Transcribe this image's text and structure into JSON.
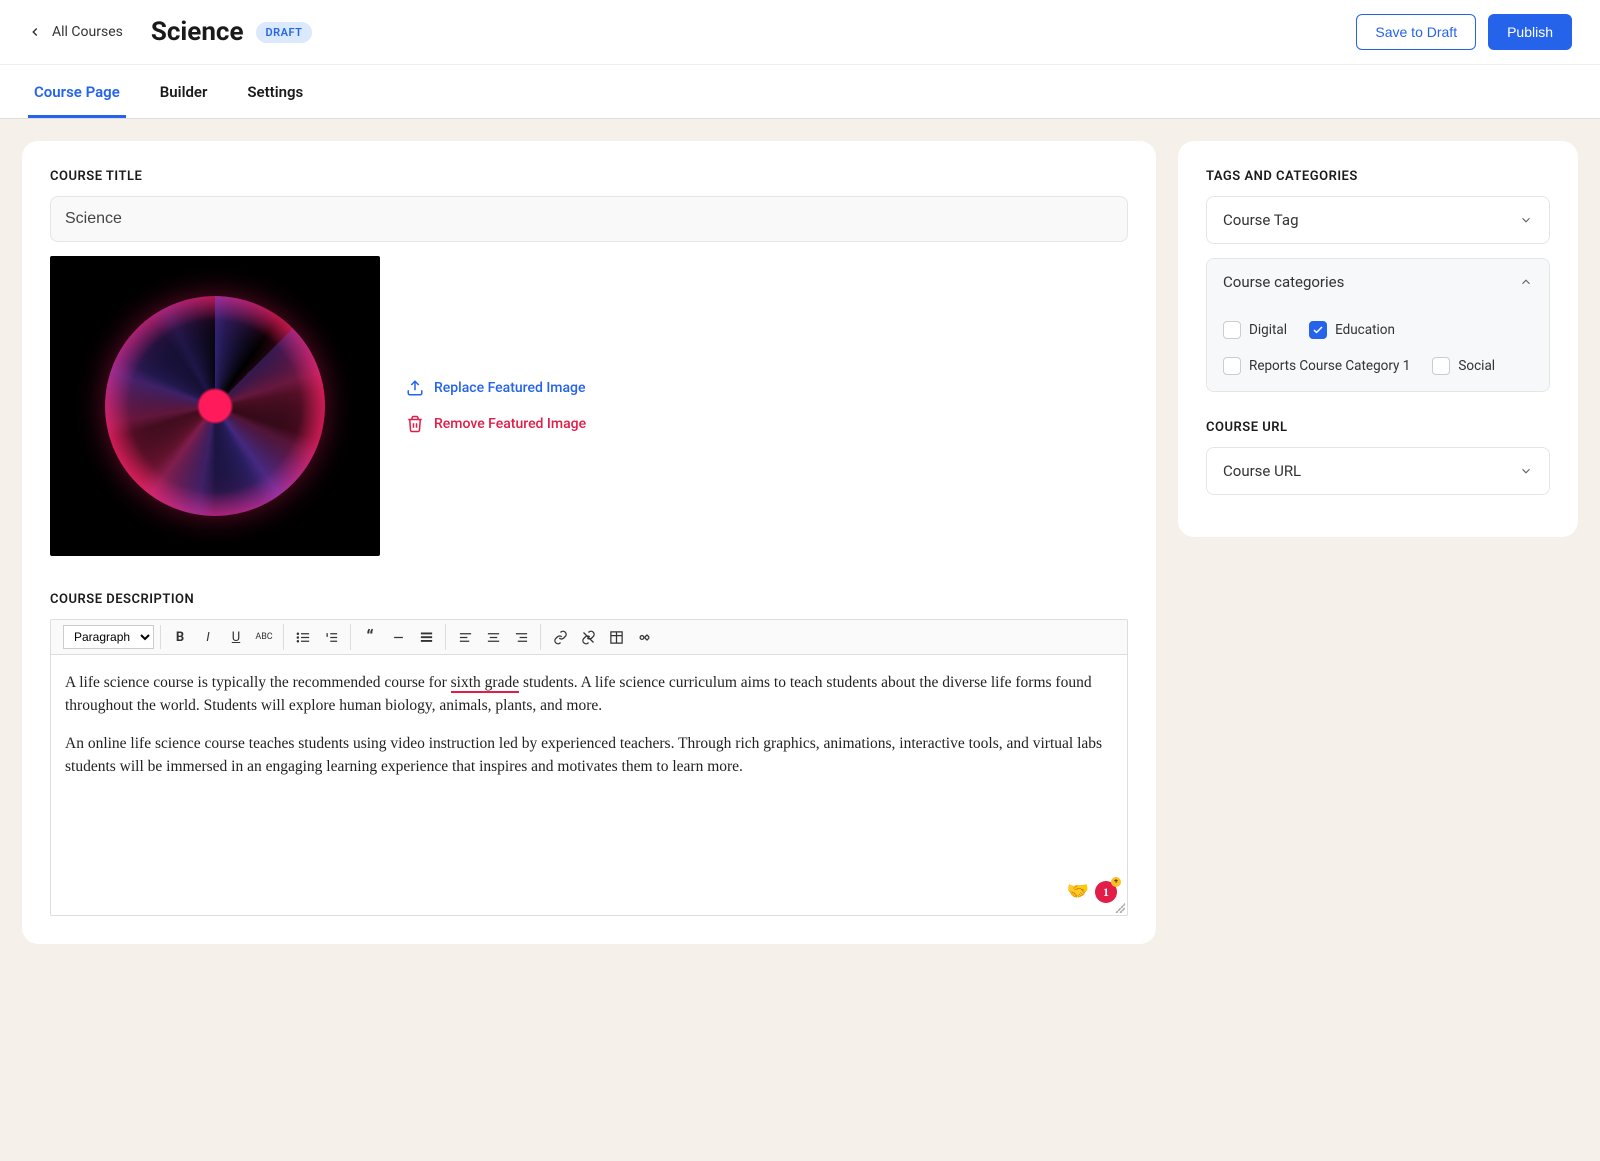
{
  "header": {
    "back_label": "All Courses",
    "title": "Science",
    "status_badge": "DRAFT",
    "save_draft_label": "Save to Draft",
    "publish_label": "Publish"
  },
  "tabs": [
    {
      "label": "Course Page",
      "active": true
    },
    {
      "label": "Builder",
      "active": false
    },
    {
      "label": "Settings",
      "active": false
    }
  ],
  "main": {
    "course_title_label": "COURSE TITLE",
    "course_title_value": "Science",
    "replace_image_label": "Replace Featured Image",
    "remove_image_label": "Remove Featured Image",
    "course_description_label": "COURSE DESCRIPTION",
    "editor_format_value": "Paragraph",
    "description_p1_pre": "A life science course is typically the recommended course for ",
    "description_p1_mark": "sixth grade",
    "description_p1_post": " students. A life science curriculum aims to teach students about the diverse life forms found throughout the world. Students will explore human biology, animals, plants, and more.",
    "description_p2": "An online life science course teaches students using video instruction led by experienced teachers. Through rich graphics, animations, interactive tools, and virtual labs students will be immersed in an engaging learning experience that inspires and motivates them to learn more.",
    "notification_count": "1"
  },
  "sidebar": {
    "tags_label": "TAGS AND CATEGORIES",
    "course_tag_label": "Course Tag",
    "course_categories_label": "Course categories",
    "categories": [
      {
        "label": "Digital",
        "checked": false
      },
      {
        "label": "Education",
        "checked": true
      },
      {
        "label": "Reports Course Category 1",
        "checked": false
      },
      {
        "label": "Social",
        "checked": false
      }
    ],
    "course_url_section_label": "COURSE URL",
    "course_url_accordion_label": "Course URL"
  }
}
